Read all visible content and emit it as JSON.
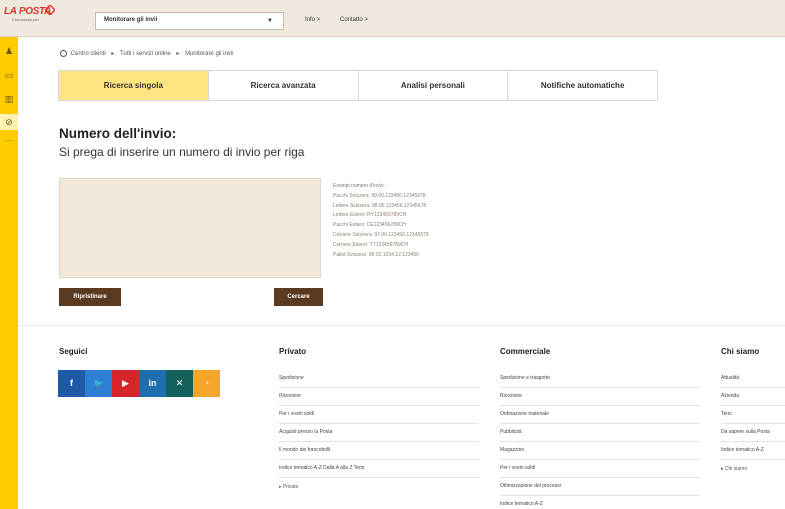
{
  "header": {
    "logo_text": "LA POSTA",
    "logo_tagline": "Conosciuto più.",
    "service_select": "Monitorare gli invii",
    "info_link": "Info >",
    "contact_link": "Contatto >"
  },
  "breadcrumb": [
    "Centro clienti",
    "Tutti i servizi online",
    "Monitorare gli invii"
  ],
  "breadcrumb_sep": "▸",
  "tabs": [
    "Ricerca singola",
    "Ricerca avanzata",
    "Analisi personali",
    "Notifiche automatiche"
  ],
  "main": {
    "heading": "Numero dell'invio:",
    "subheading": "Si prega di inserire un numero di invio per riga",
    "textarea_value": "",
    "examples_title": "Esempi numero d'invio:",
    "examples": [
      "Pacchi Svizzera: 99.00.123456.12345678",
      "Lettere Svizzera: 98.00.123456.12345678",
      "Lettere Estero: RY123456789CH",
      "Pacchi Estero: CE123456789CH",
      "Corriere Svizzera: 97.00.123456.12345678",
      "Corriere Estero: TT123456789CH",
      "Pallet Svizzera: 99.02.1234.12.123456"
    ],
    "reset_button": "Ripristinare",
    "search_button": "Cercare"
  },
  "footer": {
    "follow_title": "Seguici",
    "social": [
      {
        "icon": "facebook-icon",
        "glyph": "f",
        "color": "#1f5aa6"
      },
      {
        "icon": "twitter-icon",
        "glyph": "🐦",
        "color": "#2d7fd3"
      },
      {
        "icon": "youtube-icon",
        "glyph": "▶",
        "color": "#d7262b"
      },
      {
        "icon": "linkedin-icon",
        "glyph": "in",
        "color": "#1d6fb0"
      },
      {
        "icon": "xing-icon",
        "glyph": "✕",
        "color": "#14625b"
      },
      {
        "icon": "rss-icon",
        "glyph": "◔",
        "color": "#f4a52a"
      }
    ],
    "private_title": "Privato",
    "private_items": [
      "Spedizione",
      "Ricezione",
      "Per i vostri soldi",
      "Acquisti presso la Posta",
      "Il mondo dei francobolli",
      "Indice tematico A-Z Dalla A alla Z Temi"
    ],
    "private_more": "▸ Privato",
    "commercial_title": "Commerciale",
    "commercial_items": [
      "Spedizione e trasporto",
      "Ricezione",
      "Ordinazione materiale",
      "Pubblicità",
      "Magazzino",
      "Per i vostri soldi",
      "Ottimizzazione dei processi",
      "Indice tematico A-Z"
    ],
    "about_title": "Chi siamo",
    "about_items": [
      "Attualità",
      "Azienda",
      "Temi",
      "Da sapere sulla Posta",
      "Indice tematico A-Z"
    ],
    "about_more": "▸ Chi siamo"
  },
  "colors": {
    "brand_yellow": "#ffcc00",
    "active_tab": "#ffe581",
    "button_brown": "#5a3b21",
    "header_bg": "#efe9df"
  }
}
